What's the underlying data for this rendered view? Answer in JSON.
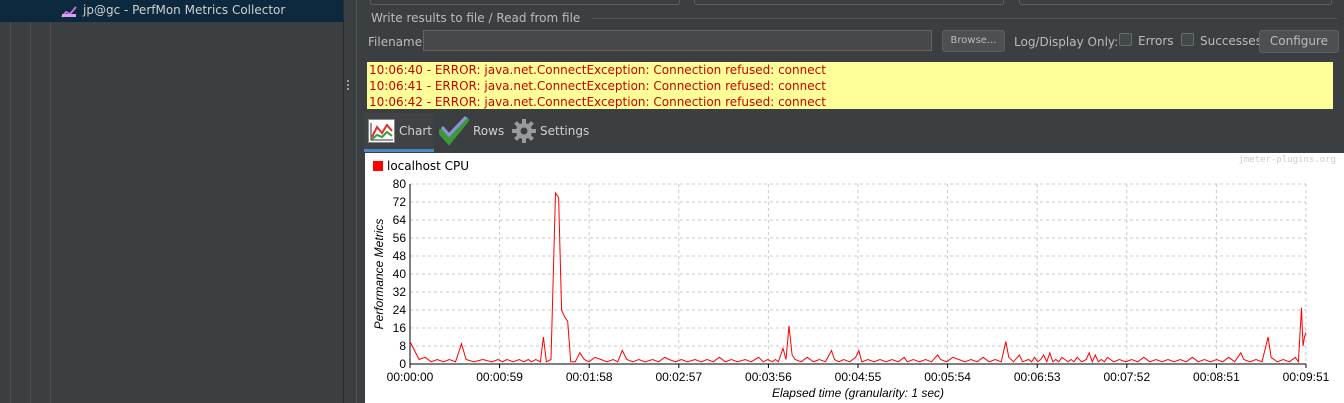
{
  "tree": {
    "selected_item": "jp@gc - PerfMon Metrics Collector"
  },
  "file_section": {
    "title": "Write results to file / Read from file",
    "filename_label": "Filename",
    "filename_value": "",
    "browse_label": "Browse...",
    "log_display_label": "Log/Display Only:",
    "errors_label": "Errors",
    "successes_label": "Successes",
    "configure_label": "Configure"
  },
  "log": {
    "lines": [
      "10:06:40 - ERROR: java.net.ConnectException: Connection refused: connect",
      "10:06:41 - ERROR: java.net.ConnectException: Connection refused: connect",
      "10:06:42 - ERROR: java.net.ConnectException: Connection refused: connect"
    ]
  },
  "tabs": {
    "chart": "Chart",
    "rows": "Rows",
    "settings": "Settings"
  },
  "watermark": "jmeter-plugins.org",
  "colors": {
    "series": "#ff0000",
    "log_background": "#ffff99",
    "log_text": "#cc0000",
    "selection": "#0d293e"
  },
  "chart_data": {
    "type": "line",
    "title": "",
    "legend": [
      "localhost CPU"
    ],
    "xlabel": "Elapsed time (granularity: 1 sec)",
    "ylabel": "Performance Metrics",
    "x_ticks": [
      "00:00:00",
      "00:00:59",
      "00:01:58",
      "00:02:57",
      "00:03:56",
      "00:04:55",
      "00:05:54",
      "00:06:53",
      "00:07:52",
      "00:08:51",
      "00:09:51"
    ],
    "y_ticks": [
      0,
      8,
      16,
      24,
      32,
      40,
      48,
      56,
      64,
      72,
      80
    ],
    "ylim": [
      0,
      80
    ],
    "xlim_seconds": [
      0,
      591
    ],
    "grid": true,
    "series": [
      {
        "name": "localhost CPU",
        "points": [
          [
            0,
            10
          ],
          [
            3,
            6
          ],
          [
            6,
            2
          ],
          [
            10,
            3
          ],
          [
            14,
            1
          ],
          [
            18,
            2
          ],
          [
            22,
            1
          ],
          [
            26,
            2
          ],
          [
            30,
            1
          ],
          [
            34,
            9
          ],
          [
            37,
            2
          ],
          [
            42,
            1
          ],
          [
            48,
            2
          ],
          [
            54,
            1
          ],
          [
            58,
            2
          ],
          [
            61,
            1
          ],
          [
            64,
            2
          ],
          [
            68,
            1
          ],
          [
            72,
            2
          ],
          [
            75,
            1
          ],
          [
            78,
            2
          ],
          [
            80,
            1
          ],
          [
            83,
            2
          ],
          [
            86,
            1
          ],
          [
            88,
            12
          ],
          [
            90,
            1
          ],
          [
            93,
            2
          ],
          [
            96,
            76
          ],
          [
            98,
            74
          ],
          [
            100,
            24
          ],
          [
            102,
            21
          ],
          [
            104,
            19
          ],
          [
            106,
            1
          ],
          [
            109,
            1
          ],
          [
            112,
            5
          ],
          [
            115,
            2
          ],
          [
            118,
            1
          ],
          [
            122,
            3
          ],
          [
            126,
            2
          ],
          [
            130,
            1
          ],
          [
            134,
            2
          ],
          [
            137,
            1
          ],
          [
            140,
            6
          ],
          [
            143,
            2
          ],
          [
            147,
            1
          ],
          [
            151,
            2
          ],
          [
            155,
            1
          ],
          [
            160,
            2
          ],
          [
            164,
            1
          ],
          [
            168,
            3
          ],
          [
            171,
            2
          ],
          [
            175,
            1
          ],
          [
            179,
            2
          ],
          [
            183,
            1
          ],
          [
            188,
            2
          ],
          [
            192,
            1
          ],
          [
            196,
            2
          ],
          [
            200,
            1
          ],
          [
            204,
            3
          ],
          [
            208,
            1
          ],
          [
            212,
            2
          ],
          [
            216,
            1
          ],
          [
            221,
            2
          ],
          [
            225,
            1
          ],
          [
            230,
            3
          ],
          [
            233,
            1
          ],
          [
            236,
            2
          ],
          [
            239,
            1
          ],
          [
            241,
            2
          ],
          [
            243,
            1
          ],
          [
            246,
            7
          ],
          [
            248,
            2
          ],
          [
            250,
            17
          ],
          [
            252,
            4
          ],
          [
            254,
            2
          ],
          [
            258,
            1
          ],
          [
            262,
            3
          ],
          [
            266,
            1
          ],
          [
            270,
            2
          ],
          [
            274,
            1
          ],
          [
            278,
            6
          ],
          [
            280,
            2
          ],
          [
            283,
            1
          ],
          [
            286,
            2
          ],
          [
            290,
            1
          ],
          [
            294,
            3
          ],
          [
            296,
            6
          ],
          [
            298,
            1
          ],
          [
            302,
            2
          ],
          [
            306,
            1
          ],
          [
            310,
            2
          ],
          [
            314,
            1
          ],
          [
            318,
            2
          ],
          [
            322,
            1
          ],
          [
            326,
            3
          ],
          [
            328,
            1
          ],
          [
            332,
            2
          ],
          [
            336,
            1
          ],
          [
            340,
            2
          ],
          [
            344,
            1
          ],
          [
            348,
            4
          ],
          [
            350,
            2
          ],
          [
            354,
            1
          ],
          [
            358,
            3
          ],
          [
            362,
            2
          ],
          [
            366,
            1
          ],
          [
            370,
            2
          ],
          [
            374,
            1
          ],
          [
            378,
            3
          ],
          [
            382,
            1
          ],
          [
            386,
            2
          ],
          [
            390,
            1
          ],
          [
            393,
            10
          ],
          [
            395,
            3
          ],
          [
            398,
            1
          ],
          [
            402,
            4
          ],
          [
            404,
            1
          ],
          [
            408,
            2
          ],
          [
            410,
            1
          ],
          [
            412,
            3
          ],
          [
            414,
            1
          ],
          [
            416,
            2
          ],
          [
            418,
            4
          ],
          [
            420,
            1
          ],
          [
            422,
            5
          ],
          [
            424,
            1
          ],
          [
            426,
            2
          ],
          [
            428,
            1
          ],
          [
            430,
            3
          ],
          [
            432,
            2
          ],
          [
            434,
            1
          ],
          [
            436,
            2
          ],
          [
            438,
            1
          ],
          [
            440,
            3
          ],
          [
            443,
            1
          ],
          [
            446,
            2
          ],
          [
            448,
            5
          ],
          [
            450,
            1
          ],
          [
            452,
            4
          ],
          [
            454,
            1
          ],
          [
            456,
            2
          ],
          [
            458,
            1
          ],
          [
            460,
            3
          ],
          [
            462,
            2
          ],
          [
            464,
            1
          ],
          [
            468,
            2
          ],
          [
            472,
            1
          ],
          [
            476,
            2
          ],
          [
            480,
            1
          ],
          [
            484,
            3
          ],
          [
            488,
            1
          ],
          [
            492,
            2
          ],
          [
            496,
            1
          ],
          [
            500,
            2
          ],
          [
            504,
            1
          ],
          [
            508,
            2
          ],
          [
            512,
            1
          ],
          [
            516,
            3
          ],
          [
            520,
            1
          ],
          [
            524,
            2
          ],
          [
            528,
            1
          ],
          [
            532,
            2
          ],
          [
            536,
            1
          ],
          [
            540,
            3
          ],
          [
            544,
            1
          ],
          [
            548,
            5
          ],
          [
            550,
            2
          ],
          [
            554,
            1
          ],
          [
            558,
            2
          ],
          [
            562,
            1
          ],
          [
            566,
            12
          ],
          [
            568,
            3
          ],
          [
            572,
            1
          ],
          [
            576,
            2
          ],
          [
            580,
            1
          ],
          [
            584,
            3
          ],
          [
            586,
            1
          ],
          [
            588,
            25
          ],
          [
            589,
            8
          ],
          [
            590,
            12
          ],
          [
            591,
            14
          ]
        ]
      }
    ]
  }
}
